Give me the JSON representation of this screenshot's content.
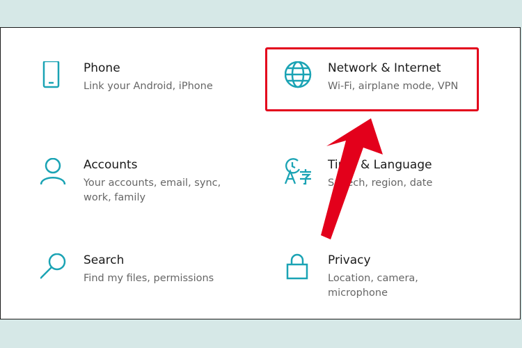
{
  "colors": {
    "accent": "#1aa3b4",
    "highlight": "#e3001b",
    "background": "#d6e8e7"
  },
  "tiles": [
    {
      "title": "Phone",
      "desc": "Link your Android, iPhone",
      "icon": "phone-icon"
    },
    {
      "title": "Network & Internet",
      "desc": "Wi-Fi, airplane mode, VPN",
      "icon": "globe-icon"
    },
    {
      "title": "Accounts",
      "desc": "Your accounts, email, sync, work, family",
      "icon": "person-icon"
    },
    {
      "title": "Time & Language",
      "desc": "Speech, region, date",
      "icon": "time-language-icon"
    },
    {
      "title": "Search",
      "desc": "Find my files, permissions",
      "icon": "search-icon"
    },
    {
      "title": "Privacy",
      "desc": "Location, camera, microphone",
      "icon": "lock-icon"
    }
  ]
}
